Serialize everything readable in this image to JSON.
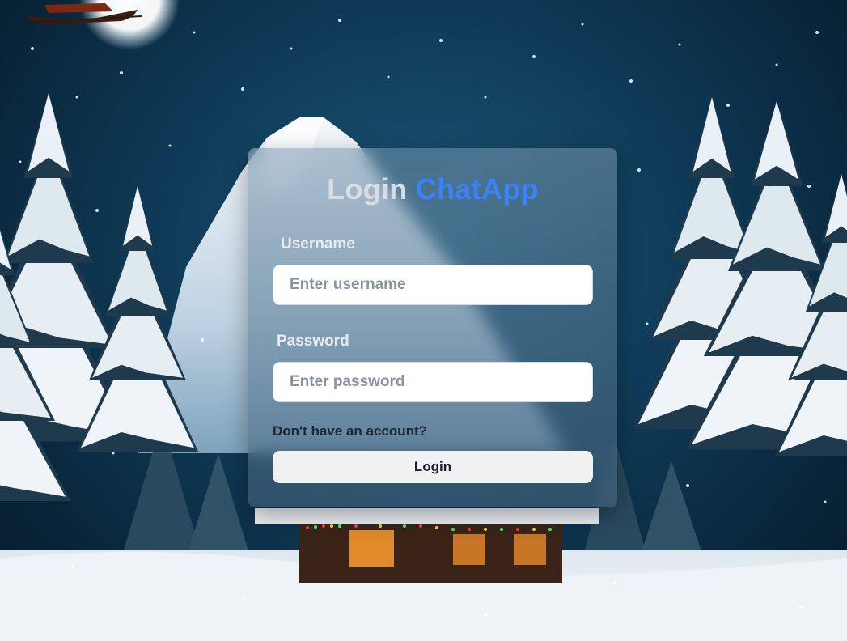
{
  "login_form": {
    "title_prefix": "Login",
    "title_brand": "ChatApp",
    "username_label": "Username",
    "username_placeholder": "Enter username",
    "username_value": "",
    "password_label": "Password",
    "password_placeholder": "Enter password",
    "password_value": "",
    "signup_link": "Don't have an account?",
    "login_button": "Login"
  },
  "colors": {
    "brand": "#3b82f6",
    "title": "#d9dde3",
    "sky": "#0f3a57",
    "snow": "#eef3f7"
  }
}
